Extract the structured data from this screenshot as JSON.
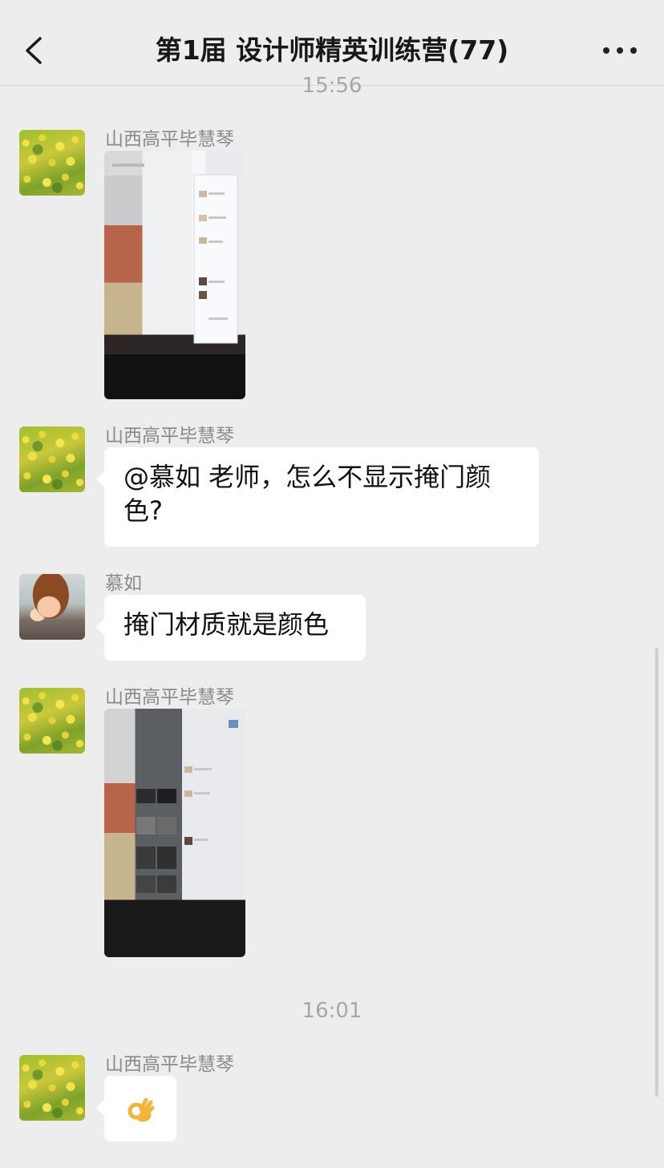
{
  "header": {
    "title": "第1届 设计师精英训练营(77)",
    "back_icon": "chevron-left-icon",
    "more_icon": "more-dots-icon"
  },
  "chat": {
    "timestamps": [
      "15:56",
      "16:01"
    ],
    "messages": [
      {
        "sender": "山西高平毕慧琴",
        "type": "image",
        "avatar": "rapeseed-flower-avatar"
      },
      {
        "sender": "山西高平毕慧琴",
        "type": "text",
        "line1": "@慕如 老师，怎么不显示掩门颜",
        "line2": "色?"
      },
      {
        "sender": "慕如",
        "type": "text",
        "text": "掩门材质就是颜色",
        "avatar": "cartoon-avatar"
      },
      {
        "sender": "山西高平毕慧琴",
        "type": "image",
        "avatar": "rapeseed-flower-avatar"
      },
      {
        "sender": "山西高平毕慧琴",
        "type": "emoji",
        "emoji": "ok-hand-emoji"
      }
    ]
  },
  "colors": {
    "background": "#ededed",
    "bubble": "#ffffff",
    "timestamp": "#a7a7a7",
    "sender": "#8a8a8a"
  }
}
